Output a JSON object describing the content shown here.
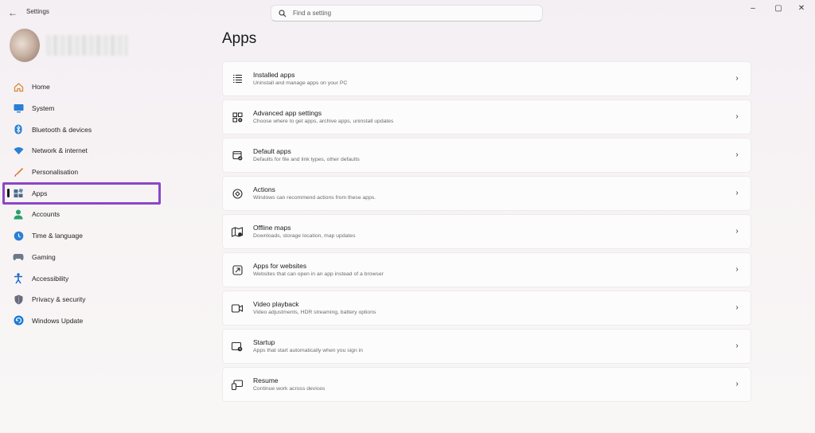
{
  "window": {
    "title": "Settings",
    "back_glyph": "←",
    "controls": {
      "minimize": "–",
      "maximize": "▢",
      "close": "✕"
    }
  },
  "search": {
    "placeholder": "Find a setting",
    "icon": "search-icon"
  },
  "sidebar": {
    "items": [
      {
        "label": "Home",
        "icon": "home-icon",
        "color": "#d98a3d"
      },
      {
        "label": "System",
        "icon": "system-icon",
        "color": "#2a7fd4"
      },
      {
        "label": "Bluetooth & devices",
        "icon": "bluetooth-icon",
        "color": "#2a7fd4"
      },
      {
        "label": "Network & internet",
        "icon": "network-icon",
        "color": "#2a7fd4"
      },
      {
        "label": "Personalisation",
        "icon": "brush-icon",
        "color": "#e0803a"
      },
      {
        "label": "Apps",
        "icon": "apps-icon",
        "color": "#4a6a8a",
        "selected": true
      },
      {
        "label": "Accounts",
        "icon": "accounts-icon",
        "color": "#2aa06a"
      },
      {
        "label": "Time & language",
        "icon": "time-language-icon",
        "color": "#2a7fd4"
      },
      {
        "label": "Gaming",
        "icon": "gaming-icon",
        "color": "#6a7a8a"
      },
      {
        "label": "Accessibility",
        "icon": "accessibility-icon",
        "color": "#1a6ac8"
      },
      {
        "label": "Privacy & security",
        "icon": "shield-icon",
        "color": "#6a6a7a"
      },
      {
        "label": "Windows Update",
        "icon": "update-icon",
        "color": "#1a7ad4"
      }
    ]
  },
  "main": {
    "title": "Apps",
    "items": [
      {
        "title": "Installed apps",
        "subtitle": "Uninstall and manage apps on your PC",
        "icon": "installed-apps-icon"
      },
      {
        "title": "Advanced app settings",
        "subtitle": "Choose where to get apps, archive apps, uninstall updates",
        "icon": "advanced-app-settings-icon"
      },
      {
        "title": "Default apps",
        "subtitle": "Defaults for file and link types, other defaults",
        "icon": "default-apps-icon"
      },
      {
        "title": "Actions",
        "subtitle": "Windows can recommend actions from these apps.",
        "icon": "actions-icon"
      },
      {
        "title": "Offline maps",
        "subtitle": "Downloads, storage location, map updates",
        "icon": "offline-maps-icon"
      },
      {
        "title": "Apps for websites",
        "subtitle": "Websites that can open in an app instead of a browser",
        "icon": "apps-for-websites-icon"
      },
      {
        "title": "Video playback",
        "subtitle": "Video adjustments, HDR streaming, battery options",
        "icon": "video-playback-icon"
      },
      {
        "title": "Startup",
        "subtitle": "Apps that start automatically when you sign in",
        "icon": "startup-icon"
      },
      {
        "title": "Resume",
        "subtitle": "Continue work across devices",
        "icon": "resume-icon"
      }
    ],
    "chevron": "›"
  },
  "colors": {
    "highlight": "#8b46c8",
    "accent": "#2a7fd4"
  }
}
